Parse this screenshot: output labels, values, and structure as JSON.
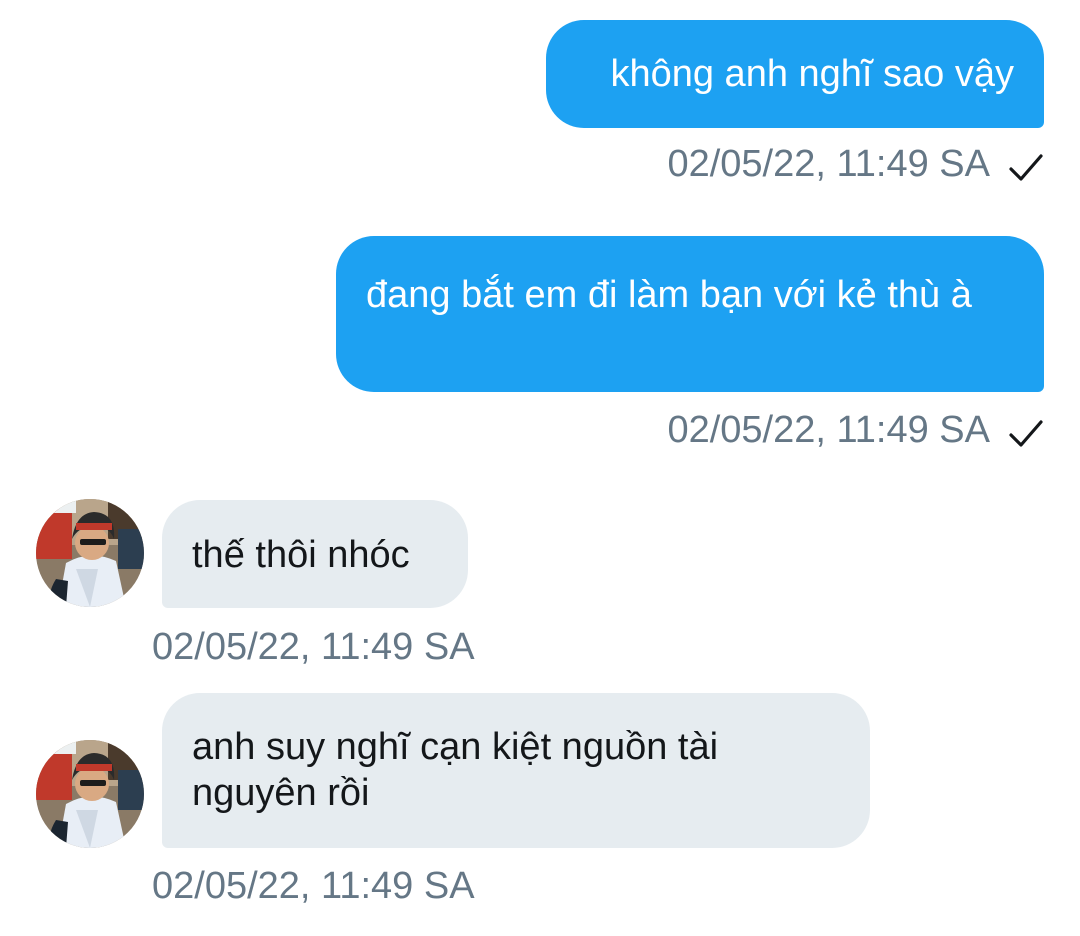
{
  "colors": {
    "outgoing_bubble": "#1da1f2",
    "incoming_bubble": "#e6ecf0",
    "timestamp": "#657786"
  },
  "messages": [
    {
      "direction": "outgoing",
      "text": "không anh nghĩ sao vậy",
      "timestamp": "02/05/22, 11:49 SA",
      "status_icon": "check-icon"
    },
    {
      "direction": "outgoing",
      "text": "đang bắt em đi làm bạn với kẻ thù à",
      "timestamp": "02/05/22, 11:49 SA",
      "status_icon": "check-icon"
    },
    {
      "direction": "incoming",
      "text": "thế thôi nhóc",
      "timestamp": "02/05/22, 11:49 SA",
      "avatar_icon": "user-avatar"
    },
    {
      "direction": "incoming",
      "text": "anh suy nghĩ cạn kiệt nguồn tài nguyên rồi",
      "timestamp": "02/05/22, 11:49 SA",
      "avatar_icon": "user-avatar"
    }
  ]
}
